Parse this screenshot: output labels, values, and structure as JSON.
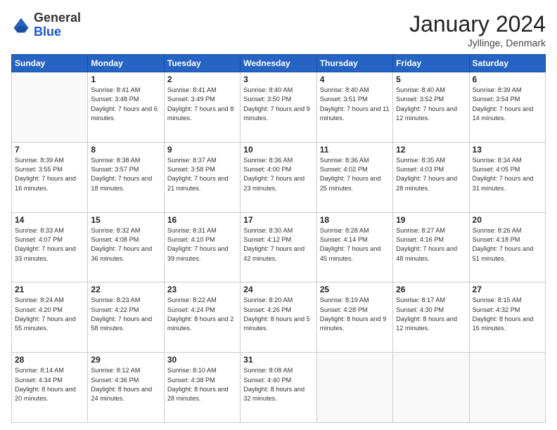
{
  "header": {
    "logo_general": "General",
    "logo_blue": "Blue",
    "month_title": "January 2024",
    "location": "Jyllinge, Denmark"
  },
  "weekdays": [
    "Sunday",
    "Monday",
    "Tuesday",
    "Wednesday",
    "Thursday",
    "Friday",
    "Saturday"
  ],
  "weeks": [
    [
      {
        "day": "",
        "info": ""
      },
      {
        "day": "1",
        "info": "Sunrise: 8:41 AM\nSunset: 3:48 PM\nDaylight: 7 hours\nand 6 minutes."
      },
      {
        "day": "2",
        "info": "Sunrise: 8:41 AM\nSunset: 3:49 PM\nDaylight: 7 hours\nand 8 minutes."
      },
      {
        "day": "3",
        "info": "Sunrise: 8:40 AM\nSunset: 3:50 PM\nDaylight: 7 hours\nand 9 minutes."
      },
      {
        "day": "4",
        "info": "Sunrise: 8:40 AM\nSunset: 3:51 PM\nDaylight: 7 hours\nand 11 minutes."
      },
      {
        "day": "5",
        "info": "Sunrise: 8:40 AM\nSunset: 3:52 PM\nDaylight: 7 hours\nand 12 minutes."
      },
      {
        "day": "6",
        "info": "Sunrise: 8:39 AM\nSunset: 3:54 PM\nDaylight: 7 hours\nand 14 minutes."
      }
    ],
    [
      {
        "day": "7",
        "info": "Sunrise: 8:39 AM\nSunset: 3:55 PM\nDaylight: 7 hours\nand 16 minutes."
      },
      {
        "day": "8",
        "info": "Sunrise: 8:38 AM\nSunset: 3:57 PM\nDaylight: 7 hours\nand 18 minutes."
      },
      {
        "day": "9",
        "info": "Sunrise: 8:37 AM\nSunset: 3:58 PM\nDaylight: 7 hours\nand 21 minutes."
      },
      {
        "day": "10",
        "info": "Sunrise: 8:36 AM\nSunset: 4:00 PM\nDaylight: 7 hours\nand 23 minutes."
      },
      {
        "day": "11",
        "info": "Sunrise: 8:36 AM\nSunset: 4:02 PM\nDaylight: 7 hours\nand 25 minutes."
      },
      {
        "day": "12",
        "info": "Sunrise: 8:35 AM\nSunset: 4:03 PM\nDaylight: 7 hours\nand 28 minutes."
      },
      {
        "day": "13",
        "info": "Sunrise: 8:34 AM\nSunset: 4:05 PM\nDaylight: 7 hours\nand 31 minutes."
      }
    ],
    [
      {
        "day": "14",
        "info": "Sunrise: 8:33 AM\nSunset: 4:07 PM\nDaylight: 7 hours\nand 33 minutes."
      },
      {
        "day": "15",
        "info": "Sunrise: 8:32 AM\nSunset: 4:08 PM\nDaylight: 7 hours\nand 36 minutes."
      },
      {
        "day": "16",
        "info": "Sunrise: 8:31 AM\nSunset: 4:10 PM\nDaylight: 7 hours\nand 39 minutes."
      },
      {
        "day": "17",
        "info": "Sunrise: 8:30 AM\nSunset: 4:12 PM\nDaylight: 7 hours\nand 42 minutes."
      },
      {
        "day": "18",
        "info": "Sunrise: 8:28 AM\nSunset: 4:14 PM\nDaylight: 7 hours\nand 45 minutes."
      },
      {
        "day": "19",
        "info": "Sunrise: 8:27 AM\nSunset: 4:16 PM\nDaylight: 7 hours\nand 48 minutes."
      },
      {
        "day": "20",
        "info": "Sunrise: 8:26 AM\nSunset: 4:18 PM\nDaylight: 7 hours\nand 51 minutes."
      }
    ],
    [
      {
        "day": "21",
        "info": "Sunrise: 8:24 AM\nSunset: 4:20 PM\nDaylight: 7 hours\nand 55 minutes."
      },
      {
        "day": "22",
        "info": "Sunrise: 8:23 AM\nSunset: 4:22 PM\nDaylight: 7 hours\nand 58 minutes."
      },
      {
        "day": "23",
        "info": "Sunrise: 8:22 AM\nSunset: 4:24 PM\nDaylight: 8 hours\nand 2 minutes."
      },
      {
        "day": "24",
        "info": "Sunrise: 8:20 AM\nSunset: 4:26 PM\nDaylight: 8 hours\nand 5 minutes."
      },
      {
        "day": "25",
        "info": "Sunrise: 8:19 AM\nSunset: 4:28 PM\nDaylight: 8 hours\nand 9 minutes."
      },
      {
        "day": "26",
        "info": "Sunrise: 8:17 AM\nSunset: 4:30 PM\nDaylight: 8 hours\nand 12 minutes."
      },
      {
        "day": "27",
        "info": "Sunrise: 8:15 AM\nSunset: 4:32 PM\nDaylight: 8 hours\nand 16 minutes."
      }
    ],
    [
      {
        "day": "28",
        "info": "Sunrise: 8:14 AM\nSunset: 4:34 PM\nDaylight: 8 hours\nand 20 minutes."
      },
      {
        "day": "29",
        "info": "Sunrise: 8:12 AM\nSunset: 4:36 PM\nDaylight: 8 hours\nand 24 minutes."
      },
      {
        "day": "30",
        "info": "Sunrise: 8:10 AM\nSunset: 4:38 PM\nDaylight: 8 hours\nand 28 minutes."
      },
      {
        "day": "31",
        "info": "Sunrise: 8:08 AM\nSunset: 4:40 PM\nDaylight: 8 hours\nand 32 minutes."
      },
      {
        "day": "",
        "info": ""
      },
      {
        "day": "",
        "info": ""
      },
      {
        "day": "",
        "info": ""
      }
    ]
  ]
}
